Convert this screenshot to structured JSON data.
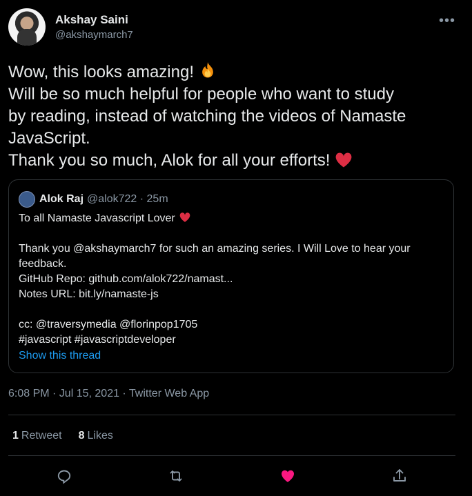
{
  "author": {
    "name": "Akshay Saini",
    "handle": "@akshaymarch7",
    "more_label": "•••"
  },
  "tweet": {
    "line1": "Wow, this looks amazing!",
    "line2": "Will be so much helpful for people who want to study",
    "line3": "by reading, instead of watching the videos of Namaste",
    "line4": "JavaScript.",
    "line5": "Thank you so much, Alok for all your efforts!"
  },
  "quote": {
    "name": "Alok Raj",
    "handle_time": "@alok722 · 25m",
    "line1": "To all Namaste Javascript Lover",
    "line2": "Thank you @akshaymarch7 for such an amazing series. I Will Love to hear your",
    "line3": "feedback.",
    "line4": "GitHub Repo: github.com/alok722/namast...",
    "line5": "Notes URL: bit.ly/namaste-js",
    "line6": "cc: @traversymedia @florinpop1705",
    "line7": "#javascript #javascriptdeveloper",
    "thread_link": "Show this thread"
  },
  "meta": {
    "timestamp": "6:08 PM · Jul 15, 2021 · Twitter Web App",
    "retweets_count": "1",
    "retweets_label": "Retweet",
    "likes_count": "8",
    "likes_label": "Likes"
  },
  "colors": {
    "background": "#000000",
    "accent": "#1d9bf0",
    "like_red": "#f91880",
    "muted": "#8b98a5"
  },
  "icons": [
    "more-icon",
    "fire-emoji",
    "heart-emoji",
    "reply-icon",
    "retweet-icon",
    "like-icon",
    "share-icon"
  ]
}
